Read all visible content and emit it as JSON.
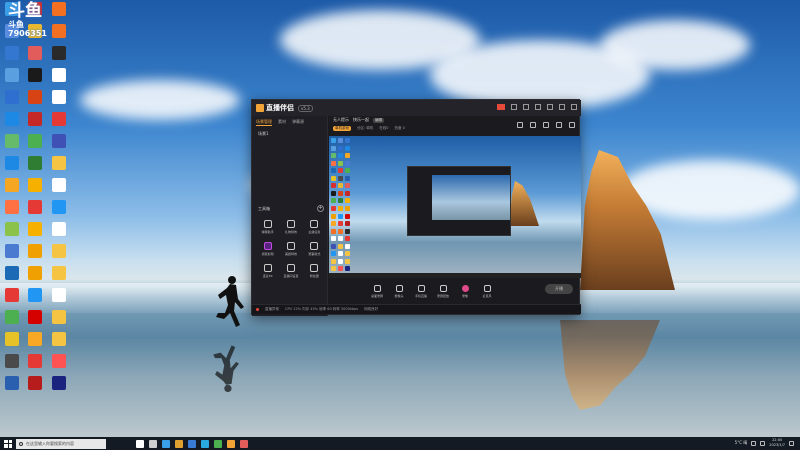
{
  "desktop": {
    "overlay_logo": {
      "line1": "斗鱼",
      "line2": "斗鱼",
      "room": "7906351"
    },
    "icons_col1": [
      "",
      "",
      "",
      "",
      "",
      "",
      "",
      "",
      "",
      "",
      "",
      "",
      "",
      "",
      "",
      "",
      "",
      "",
      ""
    ],
    "icons_col2": [
      "",
      "",
      "",
      "",
      "",
      "",
      "",
      "",
      "",
      "",
      "",
      "",
      "",
      "",
      "",
      "",
      "",
      "",
      ""
    ],
    "icons_col3": [
      "",
      "",
      "",
      "",
      "",
      "",
      "",
      "",
      "",
      "",
      "",
      "",
      "",
      "",
      "",
      "",
      "",
      "",
      ""
    ],
    "icon_colors_col1": [
      "#3aa0e8",
      "#5a8de0",
      "#3477d0",
      "#5aa0e0",
      "#2f6fd0",
      "#1e88e5",
      "#66bb6a",
      "#1e88e5",
      "#f5a623",
      "#ff7043",
      "#8bc34a",
      "#4a7bd0",
      "#1c6ab5",
      "#e53935",
      "#4caf50",
      "#e6c229",
      "#4a4a4a",
      "#2a5fb0"
    ],
    "icon_colors_col2": [
      "#d62f2f",
      "#e8b930",
      "#e25c5c",
      "#1a1a1a",
      "#d84315",
      "#c62828",
      "#4caf50",
      "#2e7d32",
      "#f5b000",
      "#e53935",
      "#f5b000",
      "#f0a000",
      "#f0a000",
      "#2196f3",
      "#d50000",
      "#f9a825",
      "#e53935",
      "#b71c1c"
    ],
    "icon_colors_col3": [
      "#f36f21",
      "#f36f21",
      "#2a2a2a",
      "#ffffff",
      "#ffffff",
      "#e53935",
      "#3f51b5",
      "#f6c443",
      "#ffffff",
      "#2196f3",
      "#ffffff",
      "#f6c443",
      "#f6c443",
      "#ffffff",
      "#f6c443",
      "#f6c443",
      "#ff5252",
      "#1a237e"
    ],
    "wallpaper_colors": {
      "sky_top": "#1d5aa8",
      "sky_mid": "#3d86cf",
      "horizon": "#dbe6ec",
      "water": "#5b86a3",
      "rock": "#c57c35"
    }
  },
  "app": {
    "name": "直播伴侣",
    "version": "v5.3",
    "sidebar_tabs": [
      "场景管理",
      "素材",
      "弹幕源"
    ],
    "scene_item": "场景1",
    "tools_title": "工具箱",
    "tools_add": "+",
    "tools": [
      {
        "label": "弹幕助手",
        "icon": "chat-icon"
      },
      {
        "label": "礼物特效",
        "icon": "gift-icon"
      },
      {
        "label": "主播任务",
        "icon": "task-icon"
      },
      {
        "label": "视频剪辑",
        "icon": "video-edit-icon"
      },
      {
        "label": "美颜特效",
        "icon": "beauty-icon"
      },
      {
        "label": "赛事模式",
        "icon": "match-icon"
      },
      {
        "label": "连麦PK",
        "icon": "pk-icon"
      },
      {
        "label": "直播间设置",
        "icon": "settings-icon"
      },
      {
        "label": "粉丝团",
        "icon": "fans-icon"
      }
    ],
    "room_title": "无人提示",
    "room_subtitle": "快乐一起",
    "room_tag": "编辑",
    "room_category": "单机游戏",
    "room_meta": [
      "分区: 单机",
      "在线0",
      "热度 0"
    ],
    "controls": [
      {
        "label": "桌面录屏",
        "icon": "screen-record-icon"
      },
      {
        "label": "摄像头",
        "icon": "camera-icon"
      },
      {
        "label": "手机直播",
        "icon": "phone-icon"
      },
      {
        "label": "录屏回放",
        "icon": "replay-icon"
      },
      {
        "label": "录像",
        "icon": "record-icon"
      },
      {
        "label": "麦克风",
        "icon": "microphone-icon"
      }
    ],
    "go_live_label": "开播",
    "status": [
      "直播异常",
      "CPU 12%  内存 45%  帧率 60  码率 3000kbps",
      "网络良好"
    ]
  },
  "taskbar": {
    "search_placeholder": "在这里输入你要搜索的内容",
    "app_colors": [
      "#ffffff",
      "#cfcfcf",
      "#3aa0e8",
      "#e0a030",
      "#3a7bd5",
      "#2aa8e0",
      "#4caf50",
      "#f3a437",
      "#e25c5c"
    ],
    "weather": "5°C 晴",
    "time": "22:00",
    "date": "2023/1/7"
  }
}
